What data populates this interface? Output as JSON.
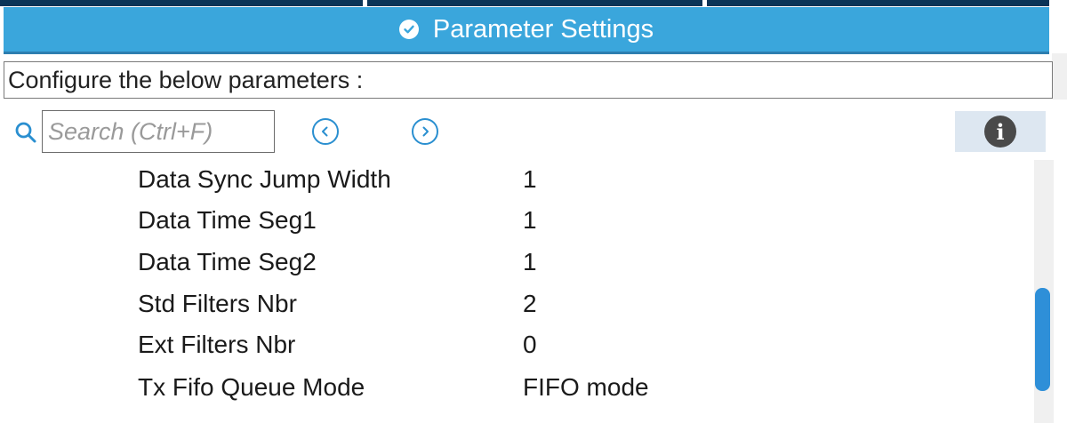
{
  "header": {
    "title": "Parameter Settings",
    "status_icon": "check-circle-icon"
  },
  "configure_label": "Configure the below parameters :",
  "search": {
    "placeholder": "Search (Ctrl+F)",
    "value": ""
  },
  "toolbar": {
    "prev_icon": "chevron-left-icon",
    "next_icon": "chevron-right-icon",
    "info_icon": "info-icon"
  },
  "params": [
    {
      "name": "Data Sync Jump Width",
      "value": "1"
    },
    {
      "name": "Data Time Seg1",
      "value": "1"
    },
    {
      "name": "Data Time Seg2",
      "value": "1"
    },
    {
      "name": "Std Filters Nbr",
      "value": "2"
    },
    {
      "name": "Ext Filters Nbr",
      "value": "0"
    },
    {
      "name": "Tx Fifo Queue Mode",
      "value": "FIFO mode"
    }
  ],
  "colors": {
    "header_bg": "#3aa6dc",
    "tab_strip": "#0a3457",
    "accent": "#2e8fd8",
    "info_panel": "#dde7f1"
  }
}
